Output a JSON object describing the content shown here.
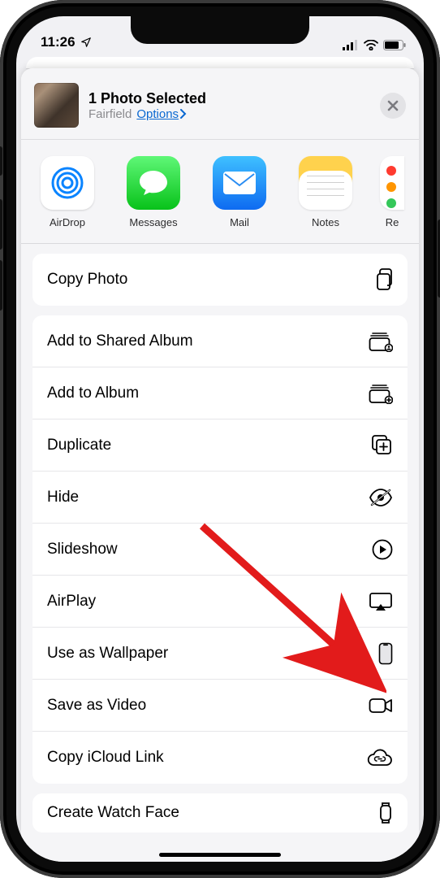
{
  "status": {
    "time": "11:26"
  },
  "header": {
    "title": "1 Photo Selected",
    "location": "Fairfield",
    "options_label": "Options"
  },
  "apps": [
    {
      "id": "airdrop",
      "label": "AirDrop"
    },
    {
      "id": "messages",
      "label": "Messages"
    },
    {
      "id": "mail",
      "label": "Mail"
    },
    {
      "id": "notes",
      "label": "Notes"
    },
    {
      "id": "reminders",
      "label": "Re"
    }
  ],
  "actions": {
    "group1": [
      {
        "id": "copy-photo",
        "label": "Copy Photo",
        "icon": "copy-icon"
      }
    ],
    "group2": [
      {
        "id": "add-shared-album",
        "label": "Add to Shared Album",
        "icon": "shared-album-icon"
      },
      {
        "id": "add-album",
        "label": "Add to Album",
        "icon": "album-add-icon"
      },
      {
        "id": "duplicate",
        "label": "Duplicate",
        "icon": "duplicate-icon"
      },
      {
        "id": "hide",
        "label": "Hide",
        "icon": "eye-off-icon"
      },
      {
        "id": "slideshow",
        "label": "Slideshow",
        "icon": "play-circle-icon"
      },
      {
        "id": "airplay",
        "label": "AirPlay",
        "icon": "airplay-icon"
      },
      {
        "id": "use-wallpaper",
        "label": "Use as Wallpaper",
        "icon": "iphone-icon"
      },
      {
        "id": "save-video",
        "label": "Save as Video",
        "icon": "video-icon"
      },
      {
        "id": "copy-icloud",
        "label": "Copy iCloud Link",
        "icon": "cloud-link-icon"
      }
    ],
    "group3": [
      {
        "id": "create-watch-face",
        "label": "Create Watch Face",
        "icon": "watch-icon"
      }
    ]
  }
}
